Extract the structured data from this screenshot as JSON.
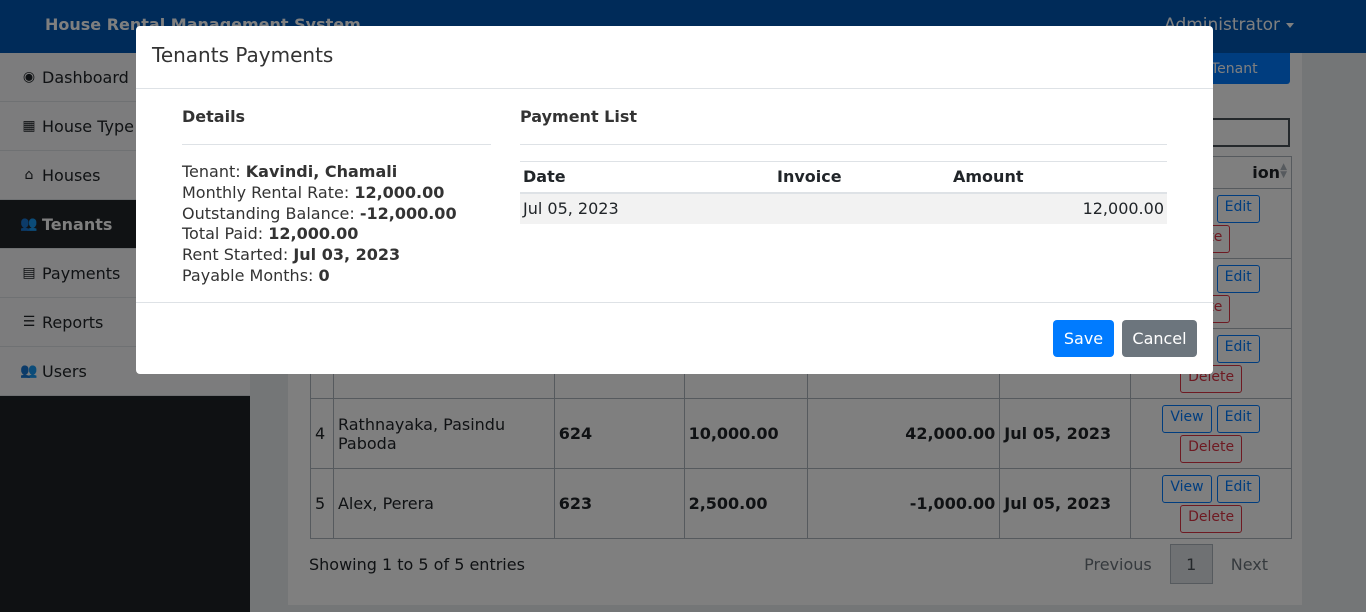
{
  "app": {
    "title": "House Rental Management System",
    "user": "Administrator"
  },
  "sidebar": {
    "items": [
      {
        "icon": "dashboard-icon",
        "glyph": "◉",
        "label": "Dashboard"
      },
      {
        "icon": "table-icon",
        "glyph": "▦",
        "label": "House Type"
      },
      {
        "icon": "home-icon",
        "glyph": "⌂",
        "label": "Houses"
      },
      {
        "icon": "users-icon",
        "glyph": "👥",
        "label": "Tenants"
      },
      {
        "icon": "file-invoice-icon",
        "glyph": "▤",
        "label": "Payments"
      },
      {
        "icon": "list-icon",
        "glyph": "☰",
        "label": "Reports"
      },
      {
        "icon": "user-group-icon",
        "glyph": "👥",
        "label": "Users"
      }
    ]
  },
  "main": {
    "new_button": "Tenant",
    "table": {
      "action_header": "ion",
      "rows": [
        {
          "no": "4",
          "name": "Rathnayaka, Pasindu Paboda",
          "house": "624",
          "rent": "10,000.00",
          "balance": "42,000.00",
          "last": "Jul 05, 2023"
        },
        {
          "no": "5",
          "name": "Alex, Perera",
          "house": "623",
          "rent": "2,500.00",
          "balance": "-1,000.00",
          "last": "Jul 05, 2023"
        }
      ],
      "view_label": "View",
      "edit_label": "Edit",
      "delete_label": "Delete",
      "partial_delete_label": "ete"
    },
    "info": "Showing 1 to 5 of 5 entries",
    "pager": {
      "previous": "Previous",
      "current": "1",
      "next": "Next"
    }
  },
  "modal": {
    "title": "Tenants Payments",
    "details": {
      "heading": "Details",
      "tenant_label": "Tenant:",
      "tenant_value": "Kavindi, Chamali",
      "rate_label": "Monthly Rental Rate:",
      "rate_value": "12,000.00",
      "balance_label": "Outstanding Balance:",
      "balance_value": "-12,000.00",
      "paid_label": "Total Paid:",
      "paid_value": "12,000.00",
      "started_label": "Rent Started:",
      "started_value": "Jul 03, 2023",
      "months_label": "Payable Months:",
      "months_value": "0"
    },
    "payments": {
      "heading": "Payment List",
      "columns": [
        "Date",
        "Invoice",
        "Amount"
      ],
      "rows": [
        {
          "date": "Jul 05, 2023",
          "invoice": "",
          "amount": "12,000.00"
        }
      ]
    },
    "save_label": "Save",
    "cancel_label": "Cancel"
  }
}
